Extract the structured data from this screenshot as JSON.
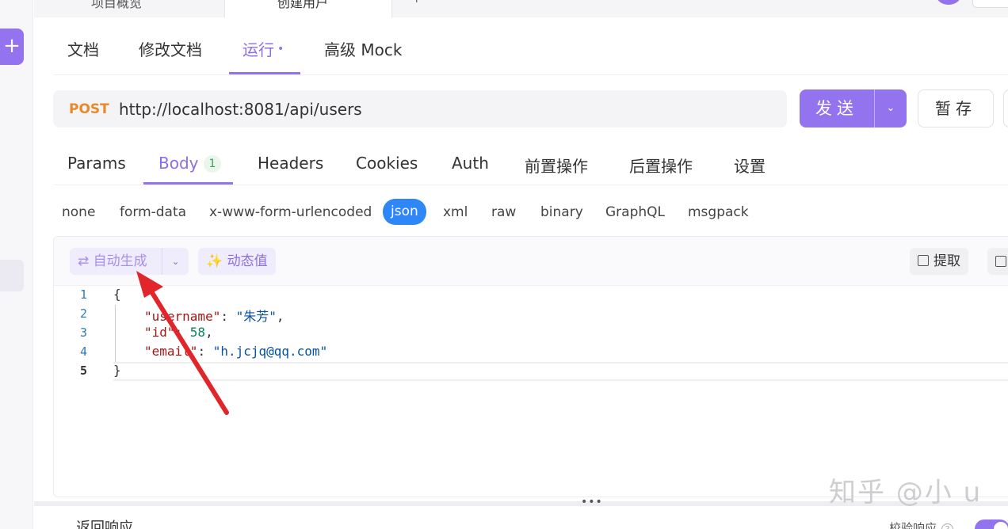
{
  "top_tabs": {
    "tab1": "项目概览",
    "tab2": "创建用户",
    "more": "+"
  },
  "doc_tabs": [
    {
      "label": "文档"
    },
    {
      "label": "修改文档"
    },
    {
      "label": "运行",
      "dot": "•"
    },
    {
      "label": "高级 Mock"
    }
  ],
  "request": {
    "method": "POST",
    "url": "http://localhost:8081/api/users",
    "send_label": "发送",
    "save_label": "暂存"
  },
  "req_tabs": [
    {
      "label": "Params"
    },
    {
      "label": "Body",
      "badge": "1"
    },
    {
      "label": "Headers"
    },
    {
      "label": "Cookies"
    },
    {
      "label": "Auth"
    },
    {
      "label": "前置操作"
    },
    {
      "label": "后置操作"
    },
    {
      "label": "设置"
    }
  ],
  "body_types": [
    "none",
    "form-data",
    "x-www-form-urlencoded",
    "json",
    "xml",
    "raw",
    "binary",
    "GraphQL",
    "msgpack"
  ],
  "body_type_selected": "json",
  "editor": {
    "auto_generate_label": "自动生成",
    "dynamic_value_label": "动态值",
    "extract_label": "提取",
    "lines": [
      {
        "n": "1",
        "open": "{"
      },
      {
        "n": "2",
        "key": "\"username\"",
        "value": "\"朱芳\"",
        "type": "str",
        "comma": ","
      },
      {
        "n": "3",
        "key": "\"id\"",
        "value": "58",
        "type": "num",
        "comma": ","
      },
      {
        "n": "4",
        "key": "\"email\"",
        "value": "\"h.jcjq@qq.com\"",
        "type": "str",
        "comma": ""
      },
      {
        "n": "5",
        "open": "}"
      }
    ]
  },
  "bottom": {
    "resize_dots": "•••",
    "section_title": "返回响应",
    "validate_label": "校验响应",
    "help": "?"
  },
  "watermark": "知乎 @小 u",
  "colors": {
    "accent": "#9373ee",
    "method": "#e8892c",
    "selected_type": "#2f86f6",
    "annotation_arrow": "#e0262b"
  }
}
